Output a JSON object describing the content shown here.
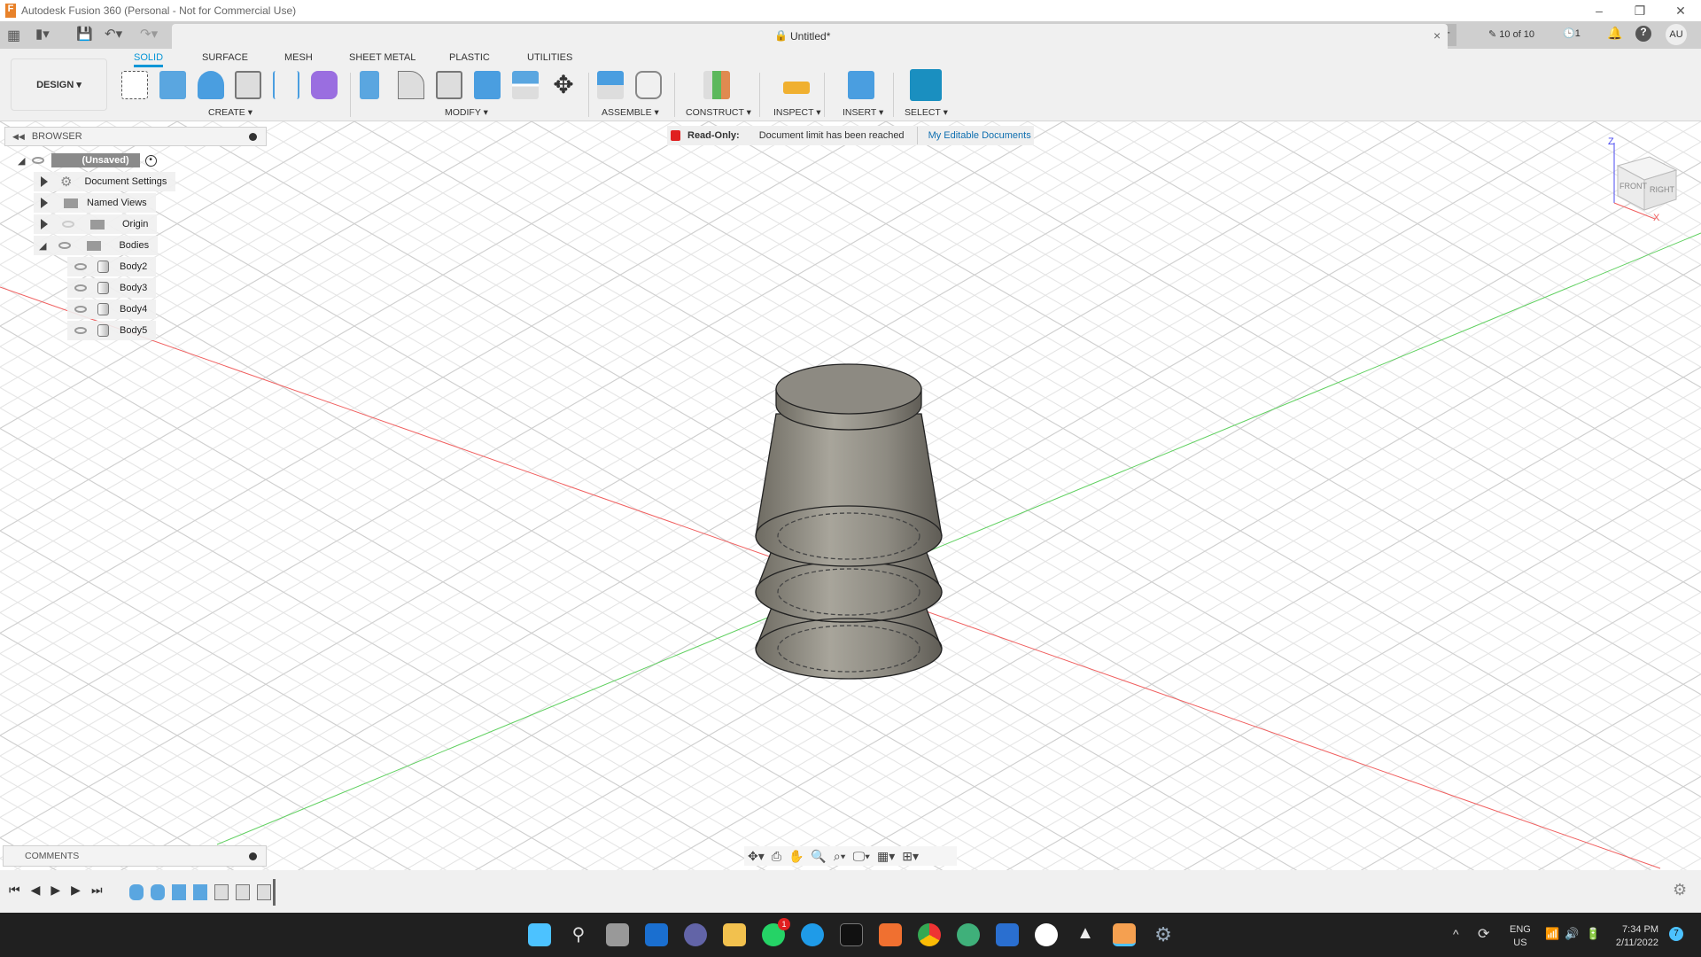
{
  "window": {
    "title": "Autodesk Fusion 360 (Personal - Not for Commercial Use)"
  },
  "document": {
    "title": "Untitled*",
    "doc_count": "10 of 10",
    "jobs": "1",
    "user": "AU"
  },
  "workspace": {
    "label": "DESIGN"
  },
  "tabs": [
    {
      "label": "SOLID",
      "active": true
    },
    {
      "label": "SURFACE"
    },
    {
      "label": "MESH"
    },
    {
      "label": "SHEET METAL"
    },
    {
      "label": "PLASTIC"
    },
    {
      "label": "UTILITIES"
    }
  ],
  "groups": [
    "CREATE",
    "MODIFY",
    "ASSEMBLE",
    "CONSTRUCT",
    "INSPECT",
    "INSERT",
    "SELECT"
  ],
  "banner": {
    "label": "Read-Only:",
    "message": "Document limit has been reached",
    "link": "My Editable Documents"
  },
  "browser": {
    "title": "BROWSER",
    "root": "(Unsaved)",
    "items": [
      "Document Settings",
      "Named Views",
      "Origin",
      "Bodies"
    ],
    "bodies": [
      "Body2",
      "Body3",
      "Body4",
      "Body5"
    ]
  },
  "comments": {
    "title": "COMMENTS"
  },
  "viewcube": {
    "front": "FRONT",
    "right": "RIGHT",
    "z": "Z",
    "x": "X"
  },
  "taskbar": {
    "lang1": "ENG",
    "lang2": "US",
    "time": "7:34 PM",
    "date": "2/11/2022",
    "notif": "7",
    "whatsapp_badge": "1"
  },
  "colors": {
    "accent": "#0696d7",
    "x_axis": "#f06060",
    "y_axis": "#60d060"
  }
}
